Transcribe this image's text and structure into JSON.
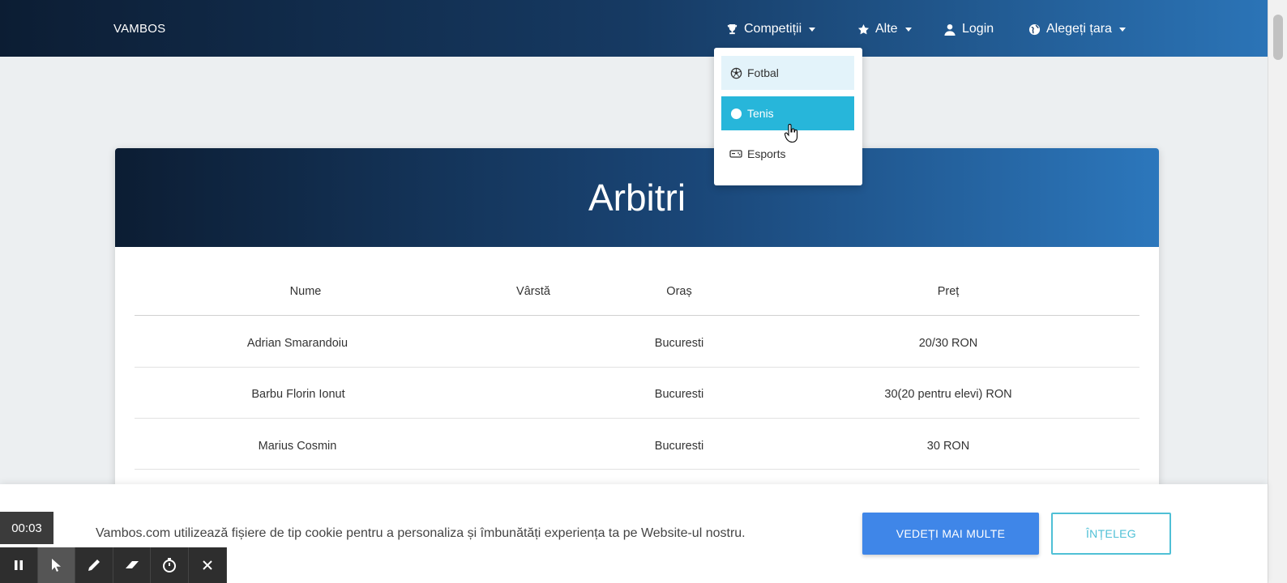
{
  "navbar": {
    "brand": "VAMBOS",
    "items": [
      {
        "label": "Competiții",
        "icon": "trophy-icon",
        "has_caret": true
      },
      {
        "label": "Alte",
        "icon": "star-icon",
        "has_caret": true
      },
      {
        "label": "Login",
        "icon": "user-icon",
        "has_caret": false
      },
      {
        "label": "Alegeți țara",
        "icon": "globe-icon",
        "has_caret": true
      }
    ]
  },
  "dropdown": {
    "items": [
      {
        "label": "Fotbal",
        "icon": "soccer-ball-icon",
        "state": "hover"
      },
      {
        "label": "Tenis",
        "icon": "tennis-ball-icon",
        "state": "active"
      },
      {
        "label": "Esports",
        "icon": "gamepad-icon",
        "state": "normal"
      }
    ]
  },
  "card": {
    "title": "Arbitri",
    "columns": [
      "Nume",
      "Vârstă",
      "Oraș",
      "Preț"
    ],
    "rows": [
      [
        "Adrian Smarandoiu",
        "",
        "Bucuresti",
        "20/30 RON"
      ],
      [
        "Barbu Florin Ionut",
        "",
        "Bucuresti",
        "30(20 pentru elevi) RON"
      ],
      [
        "Marius Cosmin",
        "",
        "Bucuresti",
        "30 RON"
      ]
    ]
  },
  "cookie": {
    "text": "Vambos.com utilizează fișiere de tip cookie pentru a personaliza și îmbunătăți experiența ta pe Website-ul nostru.",
    "more_label": "VEDEȚI MAI MULTE",
    "ok_label": "ÎNȚELEG"
  },
  "recorder": {
    "timer": "00:03",
    "tools": [
      "pause-icon",
      "pointer-icon",
      "pen-icon",
      "eraser-icon",
      "stopwatch-icon",
      "close-icon"
    ]
  },
  "colors": {
    "navbar_start": "#0c1d33",
    "navbar_end": "#2b74b7",
    "dropdown_active": "#27b6da",
    "primary_button": "#3f86e8",
    "outline_button": "#4fc0d6"
  }
}
